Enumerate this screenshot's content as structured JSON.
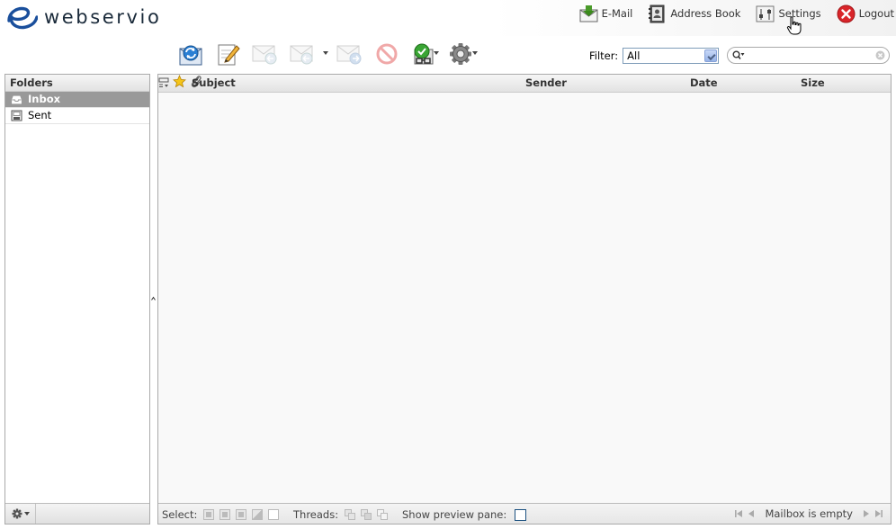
{
  "app": {
    "logo_text": "webservio"
  },
  "topnav": {
    "email": "E-Mail",
    "address_book": "Address Book",
    "settings": "Settings",
    "logout": "Logout"
  },
  "filter": {
    "label": "Filter:",
    "selected": "All"
  },
  "search": {
    "value": ""
  },
  "folders": {
    "header": "Folders",
    "items": [
      {
        "label": "Inbox",
        "selected": true
      },
      {
        "label": "Sent",
        "selected": false
      }
    ]
  },
  "messagelist": {
    "columns": {
      "subject": "Subject",
      "sender": "Sender",
      "date": "Date",
      "size": "Size"
    },
    "rows": []
  },
  "footer": {
    "select_label": "Select:",
    "threads_label": "Threads:",
    "preview_label": "Show preview pane:",
    "status": "Mailbox is empty"
  },
  "colors": {
    "selected_folder_bg": "#999999",
    "header_gradient_top": "#f6f6f6",
    "header_gradient_bottom": "#e2e2e2",
    "logo_blue": "#1a4f9c"
  }
}
